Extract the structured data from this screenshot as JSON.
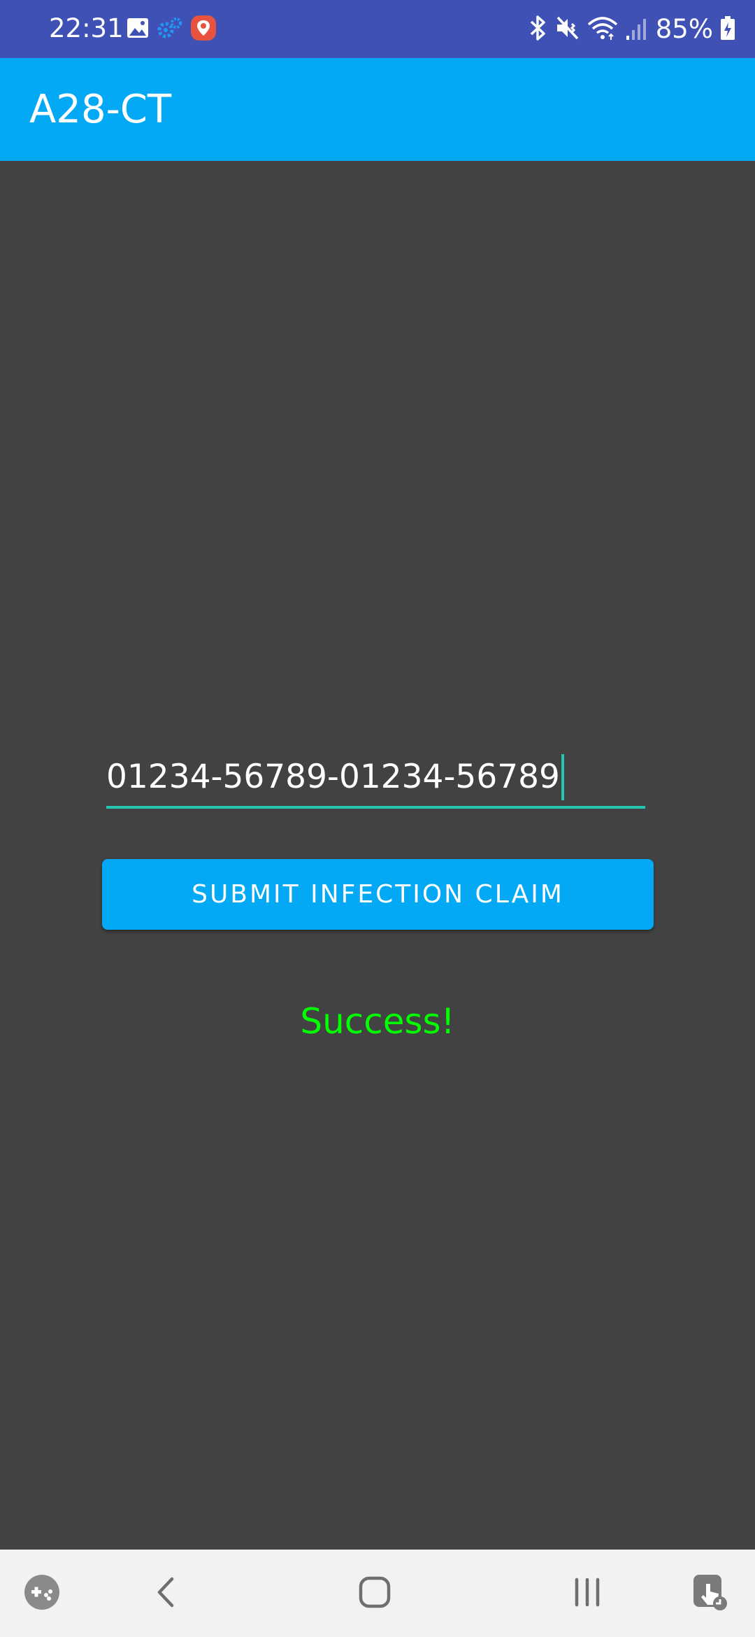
{
  "status_bar": {
    "time": "22:31",
    "battery": "85%",
    "left_icons": [
      "image-icon",
      "settings-gears-icon",
      "location-pin-icon"
    ],
    "right_icons": [
      "bluetooth-icon",
      "mute-vibrate-icon",
      "wifi-icon",
      "signal-icon",
      "battery-charging-icon"
    ]
  },
  "app_bar": {
    "title": "A28-CT"
  },
  "main": {
    "claim_input": {
      "value": "01234-56789-01234-56789"
    },
    "submit_label": "SUBMIT INFECTION CLAIM",
    "result": "Success!"
  },
  "nav_bar": {
    "icons": [
      "game-tools-icon",
      "back-icon",
      "home-icon",
      "recents-icon",
      "accessibility-touch-icon"
    ]
  },
  "colors": {
    "status_bar": "#3f51b5",
    "app_bar": "#03a9f4",
    "background": "#424242",
    "accent": "#26c6b0",
    "success": "#00ff00",
    "nav_bar": "#f2f2f2"
  }
}
